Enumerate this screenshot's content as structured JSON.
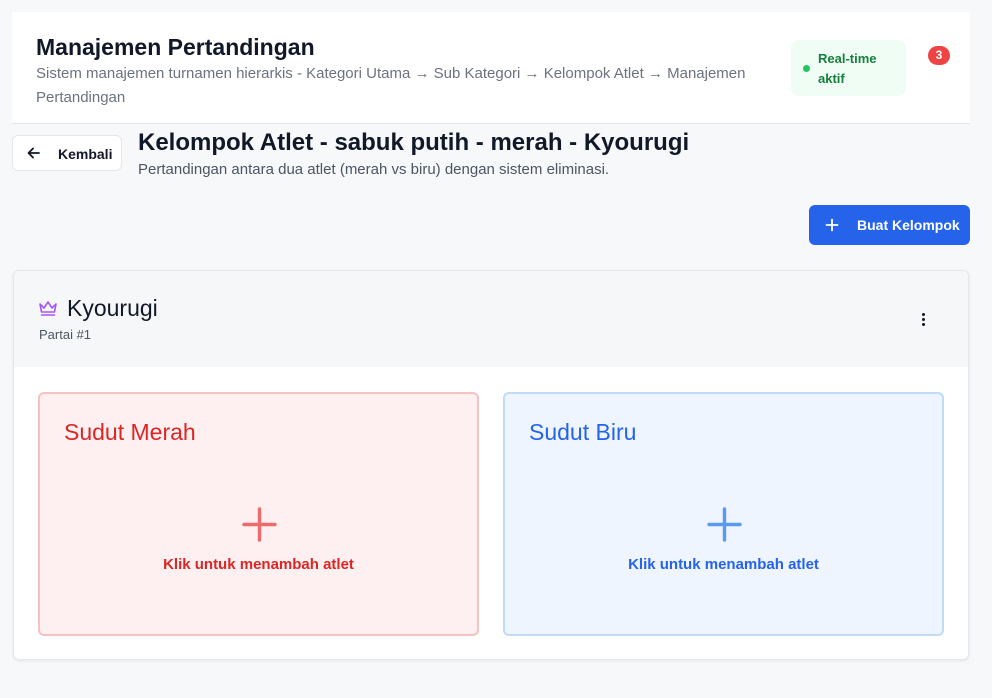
{
  "header": {
    "title": "Manajemen Pertandingan",
    "subtitle": "Sistem manajemen turnamen hierarkis - Kategori Utama → Sub Kategori → Kelompok Atlet → Manajemen Pertandingan",
    "realtime_label": "Real-time aktif",
    "notification_count": "3"
  },
  "nav": {
    "back_label": "Kembali"
  },
  "page": {
    "title": "Kelompok Atlet - sabuk putih - merah - Kyourugi",
    "subtitle": "Pertandingan antara dua atlet (merah vs biru) dengan sistem eliminasi."
  },
  "actions": {
    "create_group_label": "Buat Kelompok"
  },
  "match": {
    "title": "Kyourugi",
    "subtitle": "Partai #1",
    "red_corner": {
      "title": "Sudut Merah",
      "cta": "Klik untuk menambah atlet"
    },
    "blue_corner": {
      "title": "Sudut Biru",
      "cta": "Klik untuk menambah atlet"
    }
  },
  "colors": {
    "primary": "#2563eb",
    "red_corner": "#dc2626",
    "blue_corner": "#2563eb",
    "realtime_green": "#22c55e",
    "notification_red": "#ef4444",
    "crown_purple": "#a855f7"
  },
  "icons": [
    "arrow-left-icon",
    "plus-icon",
    "crown-icon",
    "more-vertical-icon"
  ]
}
